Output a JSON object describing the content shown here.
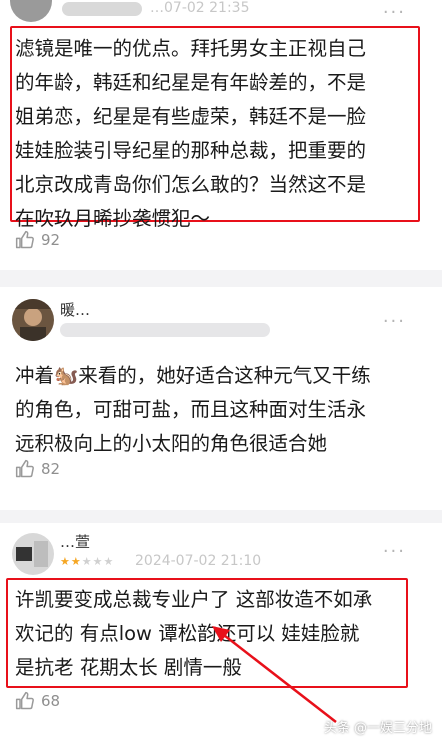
{
  "comments": [
    {
      "text": "滤镜是唯一的优点。拜托男女主正视自己\n的年龄，韩廷和纪星是有年龄差的，不是\n姐弟恋，纪星是有些虚荣，韩廷不是一脸\n娃娃脸装引导纪星的那种总裁，把重要的\n北京改成青岛你们怎么敢的？当然这不是\n在吹玖月晞抄袭惯犯～",
      "likes": "92",
      "date": "…07-02 21:35"
    },
    {
      "username": "暖…",
      "text": "冲着🐿️来看的，她好适合这种元气又干练\n的角色，可甜可盐，而且这种面对生活永\n远积极向上的小太阳的角色很适合她",
      "likes": "82",
      "more": "···"
    },
    {
      "username": "…萱",
      "rating_filled": "★★",
      "rating_empty": "★★★",
      "date": "2024-07-02 21:10",
      "text": "许凯要变成总裁专业户了 这部妆造不如承\n欢记的 有点low 谭松韵还可以 娃娃脸就\n是抗老 花期太长 剧情一般",
      "likes": "68",
      "more": "···"
    }
  ],
  "watermark": "头条 @一娱三分地",
  "colors": {
    "highlight": "#e8101a",
    "arrow": "#e8101a",
    "star": "#f5a623"
  }
}
